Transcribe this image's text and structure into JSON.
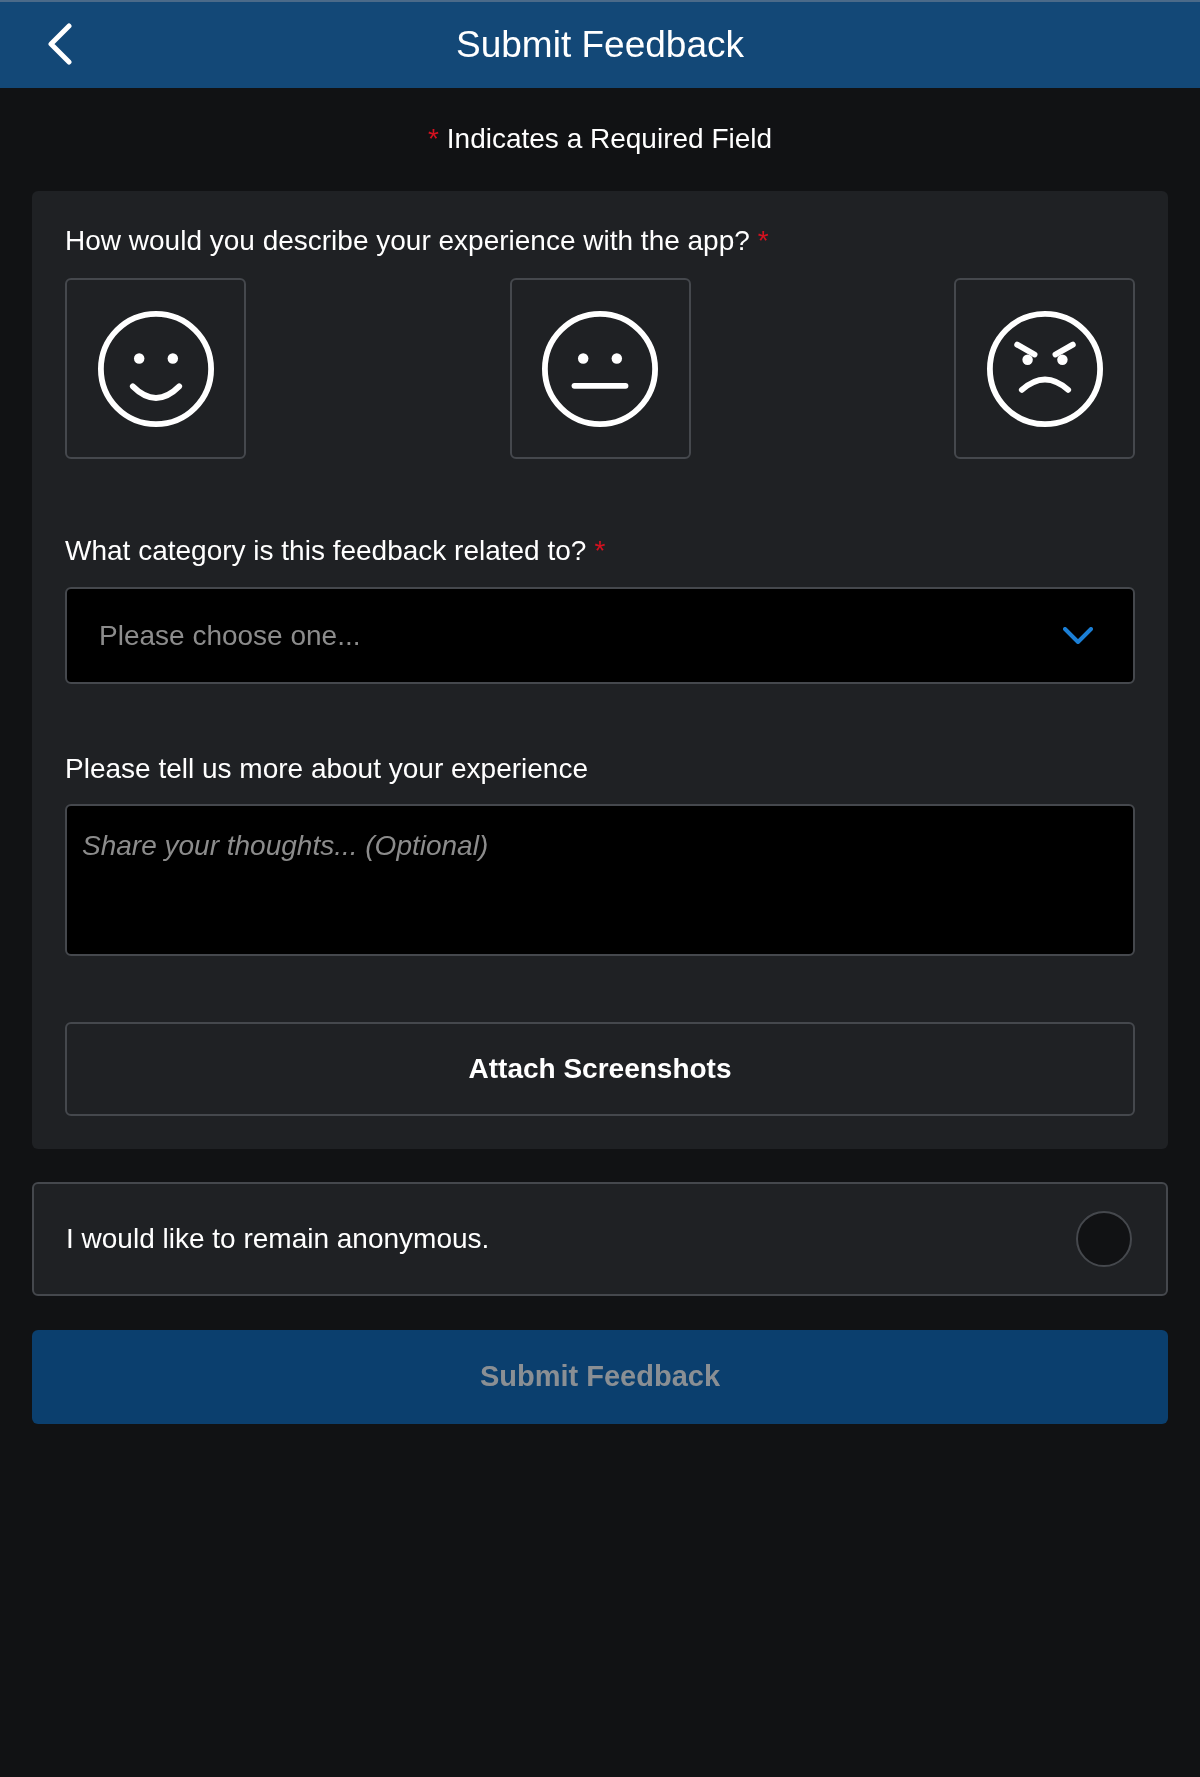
{
  "header": {
    "title": "Submit Feedback"
  },
  "required_note": {
    "mark": "*",
    "text": "Indicates a Required Field"
  },
  "form": {
    "experience": {
      "label": "How would you describe your experience with the app?",
      "required_mark": "*",
      "options": [
        {
          "kind": "happy",
          "selected": false
        },
        {
          "kind": "neutral",
          "selected": false
        },
        {
          "kind": "angry",
          "selected": false
        }
      ]
    },
    "category": {
      "label": "What category is this feedback related to?",
      "required_mark": "*",
      "placeholder": "Please choose one..."
    },
    "details": {
      "label": "Please tell us more about your experience",
      "placeholder": "Share your thoughts... (Optional)"
    },
    "attach_button": {
      "label": "Attach Screenshots"
    }
  },
  "anonymous": {
    "label": "I would like to remain anonymous.",
    "checked": false
  },
  "submit_button": {
    "label": "Submit Feedback",
    "disabled": true
  }
}
